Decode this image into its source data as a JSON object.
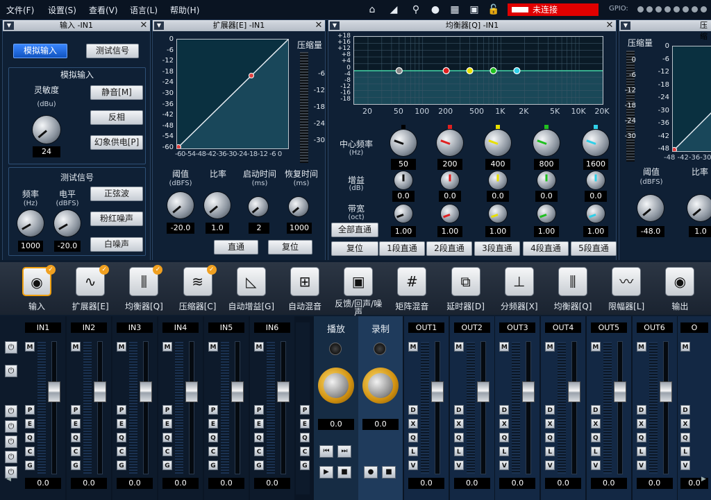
{
  "menu": [
    "文件(F)",
    "设置(S)",
    "查看(V)",
    "语言(L)",
    "帮助(H)"
  ],
  "status": "未连接",
  "gpio_label": "GPIO:",
  "input_panel": {
    "title": "输入 -IN1",
    "btn_analog": "模拟输入",
    "btn_test": "测试信号",
    "section1": "模拟输入",
    "sens_label": "灵敏度",
    "sens_unit": "(dBu)",
    "sens_value": "24",
    "mute": "静音[M]",
    "invert": "反相",
    "phantom": "幻象供电[P]",
    "section2": "测试信号",
    "freq_label": "频率",
    "freq_unit": "(Hz)",
    "level_label": "电平",
    "level_unit": "(dBFS)",
    "freq_value": "1000",
    "level_value": "-20.0",
    "sine": "正弦波",
    "pink": "粉红噪声",
    "white": "白噪声"
  },
  "expander": {
    "title": "扩展器[E] -IN1",
    "comp_label": "压缩量",
    "y_ticks": [
      "0",
      "-6",
      "-12",
      "-18",
      "-24",
      "-30",
      "-36",
      "-42",
      "-48",
      "-54",
      "-60"
    ],
    "x_ticks": "-60-54-48-42-36-30-24-18-12 -6  0",
    "meter_ticks": [
      "-6",
      "-12",
      "-18",
      "-24",
      "-30"
    ],
    "thr_label": "阈值",
    "thr_unit": "(dBFS)",
    "ratio_label": "比率",
    "attack_label": "启动时间",
    "attack_unit": "(ms)",
    "release_label": "恢复时间",
    "release_unit": "(ms)",
    "thr_value": "-20.0",
    "ratio_value": "1.0",
    "attack_value": "2",
    "release_value": "1000",
    "bypass": "直通",
    "reset": "复位"
  },
  "eq": {
    "title": "均衡器[Q] -IN1",
    "y_ticks": [
      "+18",
      "+16",
      "+12",
      "+8",
      "+4",
      "0",
      "-4",
      "-8",
      "-12",
      "-16",
      "-18"
    ],
    "x_ticks": [
      "20",
      "50",
      "100",
      "200",
      "500",
      "1K",
      "2K",
      "5K",
      "10K",
      "20K"
    ],
    "freq_label": "中心频率",
    "freq_unit": "(Hz)",
    "gain_label": "增益",
    "gain_unit": "(dB)",
    "bw_label": "带宽",
    "bw_unit": "(oct)",
    "bands": [
      {
        "freq": "50",
        "gain": "0.0",
        "bw": "1.00",
        "color": "#000000"
      },
      {
        "freq": "200",
        "gain": "0.0",
        "bw": "1.00",
        "color": "#e02020"
      },
      {
        "freq": "400",
        "gain": "0.0",
        "bw": "1.00",
        "color": "#e8e000"
      },
      {
        "freq": "800",
        "gain": "0.0",
        "bw": "1.00",
        "color": "#20c020"
      },
      {
        "freq": "1600",
        "gain": "0.0",
        "bw": "1.00",
        "color": "#30d0e8"
      }
    ],
    "all_bypass": "全部直通",
    "reset": "复位",
    "band_bypass": [
      "1段直通",
      "2段直通",
      "3段直通",
      "4段直通",
      "5段直通"
    ]
  },
  "compressor": {
    "title": "压缩",
    "comp_label": "压缩量",
    "y_ticks": [
      "0",
      "-6",
      "-12",
      "-18",
      "-24",
      "-30"
    ],
    "graph_ticks": [
      "0",
      "-6",
      "-12",
      "-18",
      "-24",
      "-30",
      "-36",
      "-42",
      "-48"
    ],
    "x_ticks": "-48 -42-36-30",
    "thr_label": "阈值",
    "thr_unit": "(dBFS)",
    "ratio_label": "比率",
    "thr_value": "-48.0",
    "ratio_value": "1.0"
  },
  "modules": [
    {
      "label": "输入",
      "icon": "xlr"
    },
    {
      "label": "扩展器[E]",
      "icon": "exp"
    },
    {
      "label": "均衡器[Q]",
      "icon": "eq"
    },
    {
      "label": "压缩器[C]",
      "icon": "comp"
    },
    {
      "label": "自动增益[G]",
      "icon": "agc"
    },
    {
      "label": "自动混音",
      "icon": "automix"
    },
    {
      "label": "反馈/回声/噪声",
      "icon": "chip"
    },
    {
      "label": "矩阵混音",
      "icon": "matrix"
    },
    {
      "label": "延时器[D]",
      "icon": "delay"
    },
    {
      "label": "分频器[X]",
      "icon": "xover"
    },
    {
      "label": "均衡器[Q]",
      "icon": "eq"
    },
    {
      "label": "限幅器[L]",
      "icon": "limiter"
    },
    {
      "label": "输出",
      "icon": "xlr"
    }
  ],
  "inputs": [
    {
      "name": "IN1",
      "value": "0.0"
    },
    {
      "name": "IN2",
      "value": "0.0"
    },
    {
      "name": "IN3",
      "value": "0.0"
    },
    {
      "name": "IN4",
      "value": "0.0"
    },
    {
      "name": "IN5",
      "value": "0.0"
    },
    {
      "name": "IN6",
      "value": "0.0"
    }
  ],
  "in_buttons": [
    "P",
    "E",
    "Q",
    "C",
    "G"
  ],
  "play": {
    "title": "播放",
    "value": "0.0"
  },
  "rec": {
    "title": "录制",
    "value": "0.0"
  },
  "outputs": [
    {
      "name": "OUT1",
      "value": "0.0"
    },
    {
      "name": "OUT2",
      "value": "0.0"
    },
    {
      "name": "OUT3",
      "value": "0.0"
    },
    {
      "name": "OUT4",
      "value": "0.0"
    },
    {
      "name": "OUT5",
      "value": "0.0"
    },
    {
      "name": "OUT6",
      "value": "0.0"
    }
  ],
  "out_buttons": [
    "D",
    "X",
    "Q",
    "L",
    "V"
  ],
  "mute_label": "M"
}
